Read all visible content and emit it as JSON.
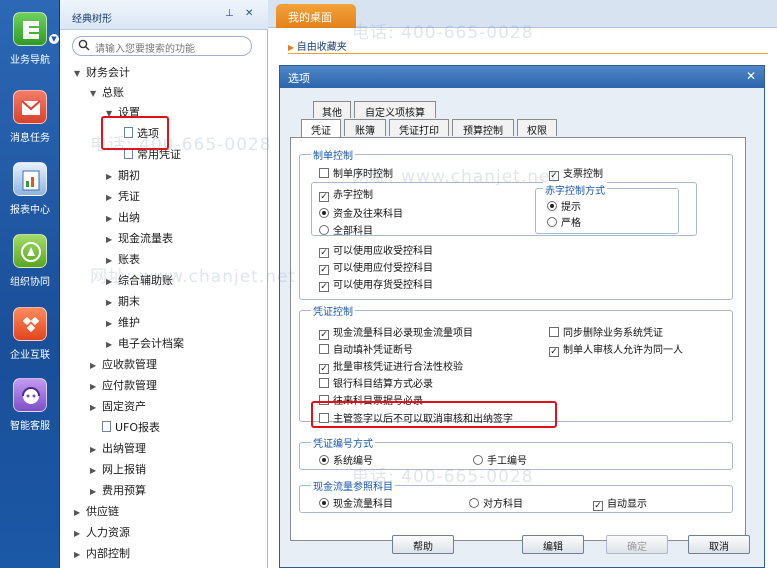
{
  "rail": {
    "items": [
      {
        "label": "业务导航",
        "icon": "business-navigation-icon"
      },
      {
        "label": "消息任务",
        "icon": "message-task-icon"
      },
      {
        "label": "报表中心",
        "icon": "report-center-icon"
      },
      {
        "label": "组织协同",
        "icon": "organization-collaboration-icon"
      },
      {
        "label": "企业互联",
        "icon": "enterprise-interconnect-icon"
      },
      {
        "label": "智能客服",
        "icon": "smart-service-icon"
      }
    ],
    "colors": {
      "accent": "#1b58a6"
    }
  },
  "tree": {
    "title": "经典树形",
    "search_placeholder": "请输入您要搜索的功能",
    "nodes": [
      "财务会计",
      "总账",
      "设置",
      "选项",
      "常用凭证",
      "期初",
      "凭证",
      "出纳",
      "现金流量表",
      "账表",
      "综合辅助账",
      "期末",
      "维护",
      "电子会计档案",
      "应收款管理",
      "应付款管理",
      "固定资产",
      "UFO报表",
      "出纳管理",
      "网上报销",
      "费用预算",
      "供应链",
      "人力资源",
      "内部控制"
    ]
  },
  "tabs": {
    "desk": "我的桌面"
  },
  "desk": {
    "favorites": "自由收藏夹"
  },
  "dialog": {
    "title": "选项",
    "tabs_row1": [
      "其他",
      "自定义项核算"
    ],
    "tabs_row2": [
      "凭证",
      "账簿",
      "凭证打印",
      "预算控制",
      "权限"
    ],
    "group_make": {
      "title": "制单控制",
      "serial": "制单序时控制",
      "ticket": "支票控制",
      "red": "赤字控制",
      "red_mode_title": "赤字控制方式",
      "prompt": "提示",
      "strict": "严格",
      "fund": "资金及往来科目",
      "all": "全部科目",
      "recv": "可以使用应收受控科目",
      "pay": "可以使用应付受控科目",
      "stock": "可以使用存货受控科目"
    },
    "group_voucher": {
      "title": "凭证控制",
      "cash": "现金流量科目必录现金流量项目",
      "sync": "同步删除业务系统凭证",
      "fill": "自动填补凭证断号",
      "same": "制单人审核人允许为同一人",
      "batch": "批量审核凭证进行合法性校验",
      "bank": "银行科目结算方式必录",
      "bill": "往来科目票据号必录",
      "supervisor": "主管签字以后不可以取消审核和出纳签字"
    },
    "group_number": {
      "title": "凭证编号方式",
      "system": "系统编号",
      "manual": "手工编号"
    },
    "group_cashref": {
      "title": "现金流量参照科目",
      "cashsubj": "现金流量科目",
      "opp": "对方科目",
      "auto": "自动显示"
    },
    "buttons": {
      "help": "帮助",
      "edit": "编辑",
      "ok": "确定",
      "cancel": "取消"
    }
  },
  "watermark": {
    "phone": "电话: 400-665-0028",
    "site": "网址: www.chanjet.net"
  },
  "highlight_color": "#e0111a"
}
